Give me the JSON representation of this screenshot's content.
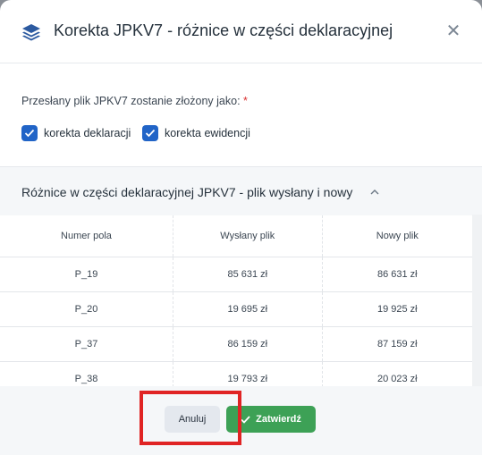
{
  "dialog": {
    "title": "Korekta JPKV7 - różnice w części deklaracyjnej",
    "close_symbol": "✕"
  },
  "form": {
    "prompt": "Przesłany plik JPKV7 zostanie złożony jako:",
    "required_mark": "*",
    "options": [
      {
        "label": "korekta deklaracji",
        "checked": true
      },
      {
        "label": "korekta ewidencji",
        "checked": true
      }
    ]
  },
  "section": {
    "title": "Różnice w części deklaracyjnej JPKV7 - plik wysłany i nowy",
    "expanded": true
  },
  "table": {
    "headers": [
      "Numer pola",
      "Wysłany plik",
      "Nowy plik"
    ],
    "rows": [
      [
        "P_19",
        "85 631 zł",
        "86 631 zł"
      ],
      [
        "P_20",
        "19 695 zł",
        "19 925 zł"
      ],
      [
        "P_37",
        "86 159 zł",
        "87 159 zł"
      ],
      [
        "P_38",
        "19 793 zł",
        "20 023 zł"
      ]
    ]
  },
  "footer": {
    "cancel_label": "Anuluj",
    "confirm_label": "Zatwierdź"
  },
  "colors": {
    "accent": "#2164c7",
    "confirm": "#3da156",
    "highlight": "#e02424"
  }
}
